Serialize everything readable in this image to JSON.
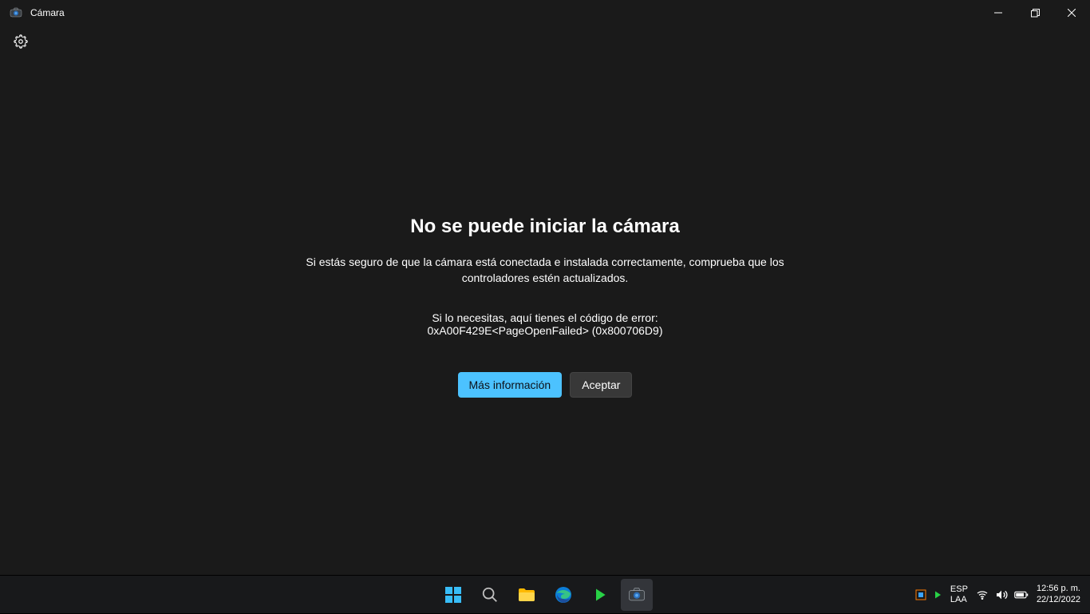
{
  "app": {
    "title": "Cámara"
  },
  "error": {
    "title": "No se puede iniciar la cámara",
    "body": "Si estás seguro de que la cámara está conectada e instalada correctamente, comprueba que los controladores estén actualizados.",
    "code_label": "Si lo necesitas, aquí tienes el código de error:",
    "code": "0xA00F429E<PageOpenFailed> (0x800706D9)",
    "more_info_label": "Más información",
    "accept_label": "Aceptar"
  },
  "taskbar": {
    "lang_primary": "ESP",
    "lang_secondary": "LAA",
    "time": "12:56 p. m.",
    "date": "22/12/2022"
  }
}
